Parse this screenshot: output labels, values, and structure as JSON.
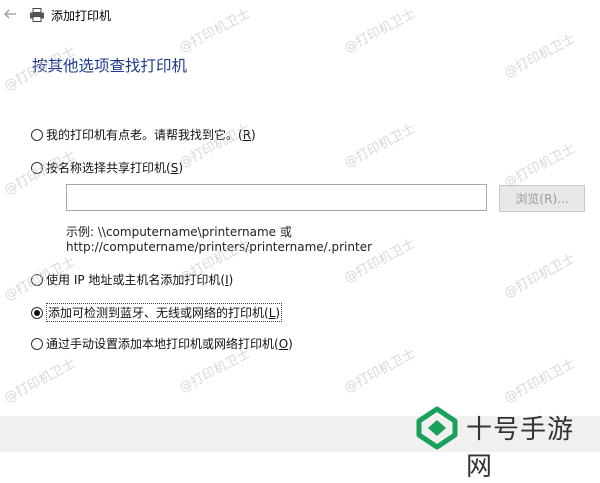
{
  "window": {
    "title": "添加打印机",
    "back_icon": "back-arrow-icon",
    "printer_icon": "printer-icon"
  },
  "heading": "按其他选项查找打印机",
  "options": [
    {
      "label": "我的打印机有点老。请帮我找到它。(",
      "accel": "R",
      "tail": ")",
      "selected": false
    },
    {
      "label": "按名称选择共享打印机(",
      "accel": "S",
      "tail": ")",
      "selected": false
    },
    {
      "label": "使用 IP 地址或主机名添加打印机(",
      "accel": "I",
      "tail": ")",
      "selected": false
    },
    {
      "label": "添加可检测到蓝牙、无线或网络的打印机(",
      "accel": "L",
      "tail": ")",
      "selected": true
    },
    {
      "label": "通过手动设置添加本地打印机或网络打印机(",
      "accel": "O",
      "tail": ")",
      "selected": false
    }
  ],
  "share": {
    "input_value": "",
    "browse_label": "浏览(R)..."
  },
  "example": {
    "line1": "示例: \\\\computername\\printername 或",
    "line2": "http://computername/printers/printername/.printer"
  },
  "watermark": "@打印机卫士",
  "brand": {
    "text": "十号手游网",
    "color": "#19a05a"
  }
}
